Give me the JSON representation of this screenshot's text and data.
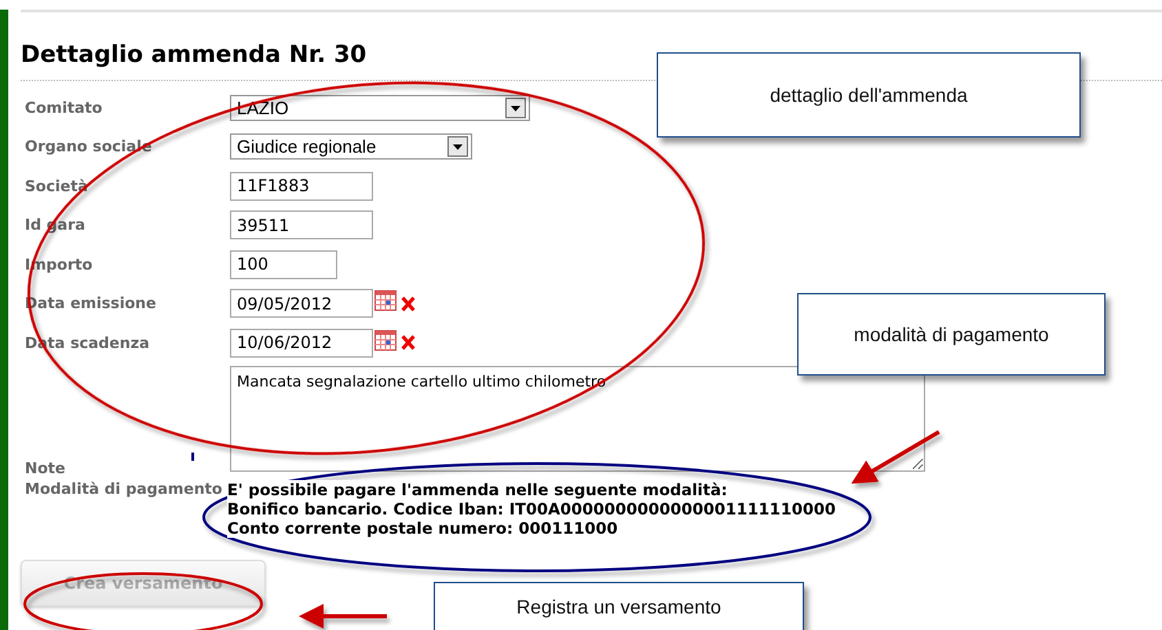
{
  "title": "Dettaglio ammenda Nr. 30",
  "fields": [
    {
      "kind": "select",
      "label": "Comitato",
      "value": "LAZIO"
    },
    {
      "kind": "select",
      "label": "Organo sociale",
      "value": "Giudice regionale"
    },
    {
      "kind": "text",
      "label": "Società",
      "value": "11F1883"
    },
    {
      "kind": "text",
      "label": "Id gara",
      "value": "39511"
    },
    {
      "kind": "text",
      "label": "Importo",
      "value": "100"
    },
    {
      "kind": "date",
      "label": "Data emissione",
      "value": "09/05/2012"
    },
    {
      "kind": "date",
      "label": "Data scadenza",
      "value": "10/06/2012"
    },
    {
      "kind": "textarea",
      "label": "Note",
      "value": "Mancata segnalazione cartello ultimo chilometro"
    }
  ],
  "payment": {
    "label": "Modalità di pagamento",
    "lines": [
      "E' possibile pagare l'ammenda nelle seguente modalità:",
      "Bonifico bancario. Codice Iban: IT00A0000000000000001111110000",
      "Conto corrente postale numero: 000111000"
    ]
  },
  "button": {
    "label": "Crea versamento",
    "disabled": true
  },
  "callouts": [
    {
      "text": "dettaglio dell'ammenda"
    },
    {
      "text": "modalità di pagamento"
    },
    {
      "text": "Registra un versamento"
    }
  ]
}
